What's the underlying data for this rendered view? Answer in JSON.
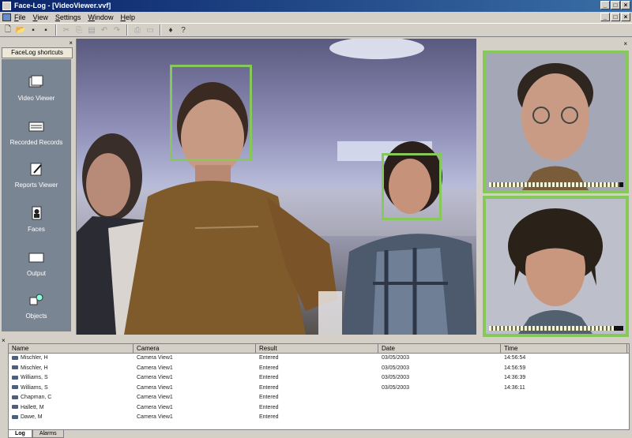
{
  "window": {
    "title": "Face-Log - [VideoViewer.vvf]"
  },
  "menu": [
    "File",
    "View",
    "Settings",
    "Window",
    "Help"
  ],
  "toolbar": {
    "icons": [
      "new-icon",
      "open-icon",
      "save-icon",
      "save-all-icon",
      "cut-icon",
      "copy-icon",
      "paste-icon",
      "undo-icon",
      "redo-icon",
      "print-icon",
      "print-preview-icon",
      "bulb-icon",
      "help-pointer-icon"
    ]
  },
  "shortcuts": {
    "header": "FaceLog shortcuts",
    "items": [
      {
        "label": "Video Viewer",
        "icon": "video-viewer-icon"
      },
      {
        "label": "Recorded Records",
        "icon": "recorded-records-icon"
      },
      {
        "label": "Reports Viewer",
        "icon": "reports-viewer-icon"
      },
      {
        "label": "Faces",
        "icon": "faces-icon"
      },
      {
        "label": "Output",
        "icon": "output-icon"
      },
      {
        "label": "Objects",
        "icon": "objects-icon"
      }
    ]
  },
  "detection_color": "#86c85a",
  "faces": [
    {
      "meter_level": 0.97
    },
    {
      "meter_level": 0.93
    }
  ],
  "log": {
    "columns": [
      "Name",
      "Camera",
      "Result",
      "Date",
      "Time"
    ],
    "rows": [
      [
        "Mischler, H",
        "Camera View1",
        "Entered",
        "03/05/2003",
        "14:56:54"
      ],
      [
        "Mischler, H",
        "Camera View1",
        "Entered",
        "03/05/2003",
        "14:56:59"
      ],
      [
        "Williams, S",
        "Camera View1",
        "Entered",
        "03/05/2003",
        "14:36:39"
      ],
      [
        "Williams, S",
        "Camera View1",
        "Entered",
        "03/05/2003",
        "14:36:11"
      ],
      [
        "Chapman, C",
        "Camera View1",
        "Entered",
        "",
        ""
      ],
      [
        "Hallett, M",
        "Camera View1",
        "Entered",
        "",
        ""
      ],
      [
        "Dawe, M",
        "Camera View1",
        "Entered",
        "",
        ""
      ]
    ],
    "tabs": [
      "Log",
      "Alarms"
    ]
  }
}
